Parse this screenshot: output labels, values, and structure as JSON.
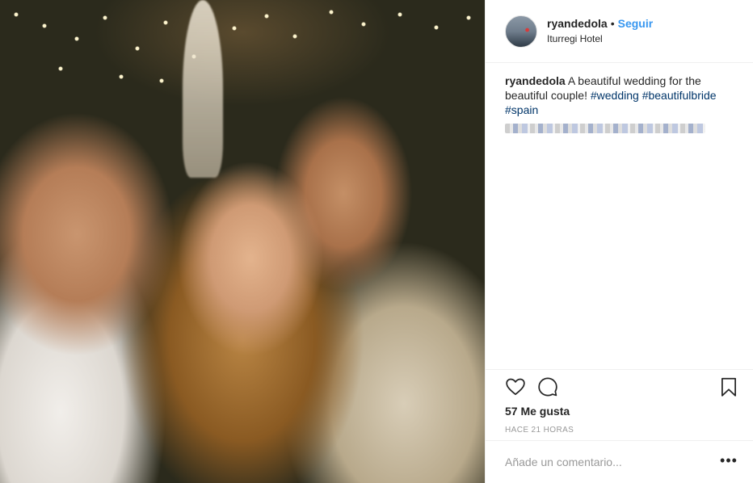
{
  "post": {
    "photo_alt": "",
    "user": {
      "username": "ryandedola",
      "separator": "•",
      "follow_label": "Seguir",
      "location": "Iturregi Hotel"
    },
    "caption": {
      "username": "ryandedola",
      "text": "A beautiful wedding for the beautiful couple!",
      "hashtags": [
        "#wedding",
        "#beautifulbride",
        "#spain"
      ]
    },
    "actions": {
      "like_icon": "heart-icon",
      "comment_icon": "comment-icon",
      "save_icon": "bookmark-icon"
    },
    "likes": "57 Me gusta",
    "timestamp": "HACE 21 HORAS",
    "comment_box": {
      "placeholder": "Añade un comentario...",
      "more_label": "•••"
    }
  },
  "colors": {
    "link_blue": "#3897f0",
    "hashtag": "#003569",
    "muted": "#999999",
    "border": "#efefef"
  }
}
